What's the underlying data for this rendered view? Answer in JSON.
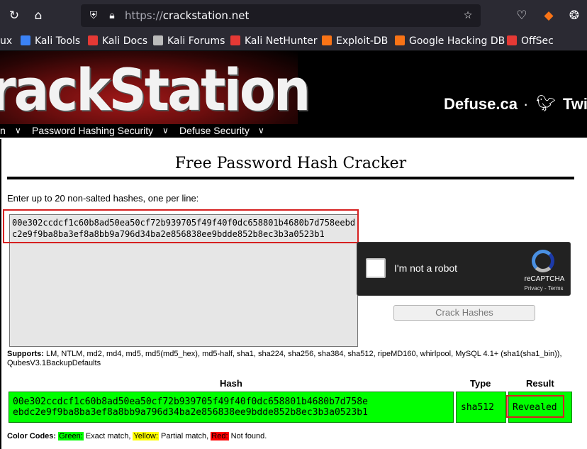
{
  "browser": {
    "url_scheme": "https://",
    "url_domain": "crackstation.net",
    "bookmarks": [
      {
        "label": "ux",
        "color": "#2b2a33"
      },
      {
        "label": "Kali Tools",
        "color": "#3b82f6"
      },
      {
        "label": "Kali Docs",
        "color": "#e53935"
      },
      {
        "label": "Kali Forums",
        "color": "#fbfbfe"
      },
      {
        "label": "Kali NetHunter",
        "color": "#e53935"
      },
      {
        "label": "Exploit-DB",
        "color": "#f97316"
      },
      {
        "label": "Google Hacking DB",
        "color": "#f97316"
      },
      {
        "label": "OffSec",
        "color": "#e53935"
      }
    ]
  },
  "header": {
    "logo": "rackStation",
    "defuse": "Defuse.ca",
    "separator": "·",
    "twitter": "Twi"
  },
  "nav": {
    "items": [
      "n",
      "Password Hashing Security",
      "Defuse Security"
    ]
  },
  "main": {
    "title": "Free Password Hash Cracker",
    "instructions": "Enter up to 20 non-salted hashes, one per line:",
    "hash_input": "00e302ccdcf1c60b8ad50ea50cf72b939705f49f40f0dc658801b4680b7d758eebd\nc2e9f9ba8ba3ef8a8bb9a796d34ba2e856838ee9bdde852b8ec3b3a0523b1",
    "captcha_label": "I'm not a robot",
    "captcha_brand": "reCAPTCHA",
    "captcha_links": "Privacy - Terms",
    "crack_button": "Crack Hashes",
    "supports_label": "Supports:",
    "supports_text": " LM, NTLM, md2, md4, md5, md5(md5_hex), md5-half, sha1, sha224, sha256, sha384, sha512, ripeMD160, whirlpool, MySQL 4.1+ (sha1(sha1_bin)), QubesV3.1BackupDefaults"
  },
  "results": {
    "headers": {
      "hash": "Hash",
      "type": "Type",
      "result": "Result"
    },
    "rows": [
      {
        "hash": "00e302ccdcf1c60b8ad50ea50cf72b939705f49f40f0dc658801b4680b7d758e\nebdc2e9f9ba8ba3ef8a8bb9a796d34ba2e856838ee9bdde852b8ec3b3a0523b1",
        "type": "sha512",
        "result": "Revealed"
      }
    ]
  },
  "color_codes": {
    "label": "Color Codes:",
    "green": "Green:",
    "green_desc": " Exact match, ",
    "yellow": "Yellow:",
    "yellow_desc": " Partial match, ",
    "red": "Red:",
    "red_desc": " Not found."
  },
  "colors": {
    "match_green": "#00ff00",
    "partial_yellow": "#ffff00",
    "notfound_red": "#ff0000",
    "highlight_red": "#d62020"
  }
}
